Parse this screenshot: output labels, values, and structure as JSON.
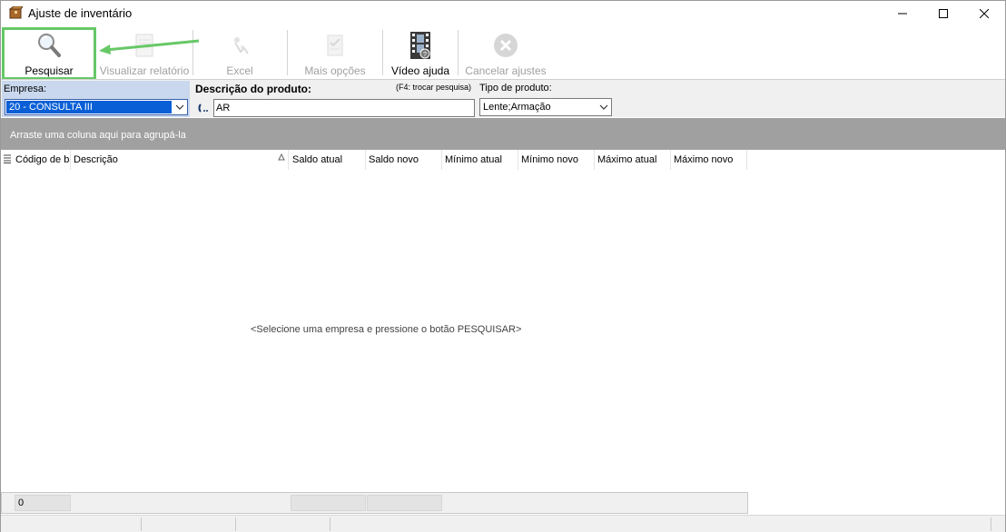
{
  "window": {
    "title": "Ajuste de inventário"
  },
  "toolbar": {
    "buttons": [
      {
        "label": "Pesquisar",
        "icon": "magnifier-icon",
        "enabled": true
      },
      {
        "label": "Visualizar relatório",
        "icon": "report-icon",
        "enabled": false
      },
      {
        "label": "Excel",
        "icon": "excel-icon",
        "enabled": false
      },
      {
        "label": "Mais opções",
        "icon": "more-options-icon",
        "enabled": false
      },
      {
        "label": "Vídeo ajuda",
        "icon": "film-icon",
        "enabled": true
      },
      {
        "label": "Cancelar ajustes",
        "icon": "cancel-icon",
        "enabled": false
      }
    ],
    "highlight_color": "#67c867"
  },
  "filters": {
    "empresa": {
      "label": "Empresa:",
      "value": "20 - CONSULTA III"
    },
    "descricao": {
      "label": "Descrição do produto:",
      "hint": "(F4: trocar pesquisa)",
      "value": "AR"
    },
    "tipo": {
      "label": "Tipo de produto:",
      "value": "Lente;Armação"
    }
  },
  "grid": {
    "group_hint": "Arraste uma coluna aqui para agrupá-la",
    "columns": [
      "Código de ba",
      "Descrição",
      "Saldo atual",
      "Saldo novo",
      "Mínimo atual",
      "Mínimo novo",
      "Máximo atual",
      "Máximo novo"
    ],
    "empty_message": "<Selecione uma empresa e pressione o botão PESQUISAR>",
    "footer_count": "0"
  },
  "colors": {
    "group_bar": "#a0a0a0",
    "selection": "#0a5fd6",
    "empresa_panel": "#c9d8ee"
  }
}
